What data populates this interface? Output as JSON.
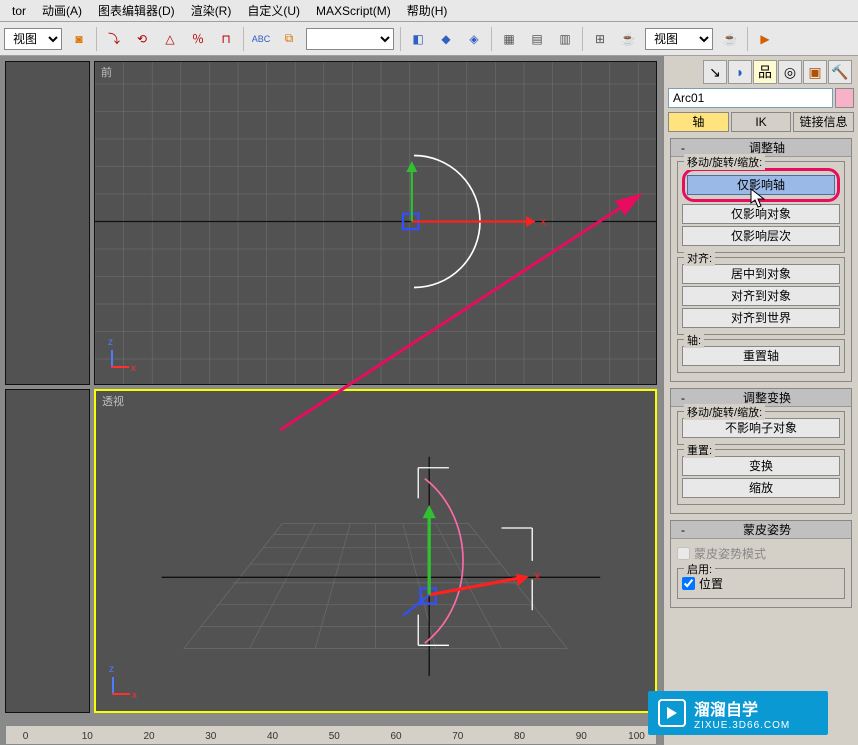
{
  "menubar": {
    "items": [
      "tor",
      "动画(A)",
      "图表编辑器(D)",
      "渲染(R)",
      "自定义(U)",
      "MAXScript(M)",
      "帮助(H)"
    ]
  },
  "toolbar": {
    "leftSelectLabel": "视图",
    "rightSelectLabel": "视图",
    "icons": [
      "snap-icon",
      "angle-snap-icon",
      "magnet-icon",
      "pivot-icon",
      "u-icon",
      "horseshoe-icon",
      "abc-icon",
      "align-icon",
      "arrows-icon",
      "diamond-icon",
      "cube-icon",
      "cone-icon",
      "list-icon",
      "grid-icon",
      "grid2-icon",
      "multi-icon",
      "teapot-icon",
      "teapot-wire-icon",
      "cmd-icon"
    ]
  },
  "viewports": {
    "front": {
      "label": "前"
    },
    "perspective": {
      "label": "透视"
    }
  },
  "objectName": "Arc01",
  "tabs": {
    "axis": "轴",
    "ik": "IK",
    "link": "链接信息"
  },
  "rollouts": {
    "adjustPivot": {
      "title": "调整轴",
      "moveSection": "移动/旋转/缩放:",
      "affectPivot": "仅影响轴",
      "affectObject": "仅影响对象",
      "affectHierarchy": "仅影响层次",
      "alignSection": "对齐:",
      "centerToObject": "居中到对象",
      "alignToObject": "对齐到对象",
      "alignToWorld": "对齐到世界",
      "pivotSection": "轴:",
      "resetPivot": "重置轴"
    },
    "adjustTransform": {
      "title": "调整变换",
      "moveSection": "移动/旋转/缩放:",
      "dontAffectChildren": "不影响子对象",
      "resetSection": "重置:",
      "transform": "变换",
      "scale": "缩放"
    },
    "skinPose": {
      "title": "蒙皮姿势",
      "skinPoseModel": "蒙皮姿势模式",
      "enable": "启用:",
      "position": "位置"
    }
  },
  "ruler": {
    "ticks": [
      "0",
      "10",
      "20",
      "30",
      "40",
      "50",
      "60",
      "70",
      "80",
      "90",
      "100"
    ]
  },
  "watermark": {
    "title": "溜溜自学",
    "url": "ZIXUE.3D66.COM"
  },
  "toolIcons": [
    "arrow-icon",
    "arc-icon",
    "hierarchy-icon",
    "wheel-icon",
    "film-icon",
    "hammer-icon"
  ]
}
